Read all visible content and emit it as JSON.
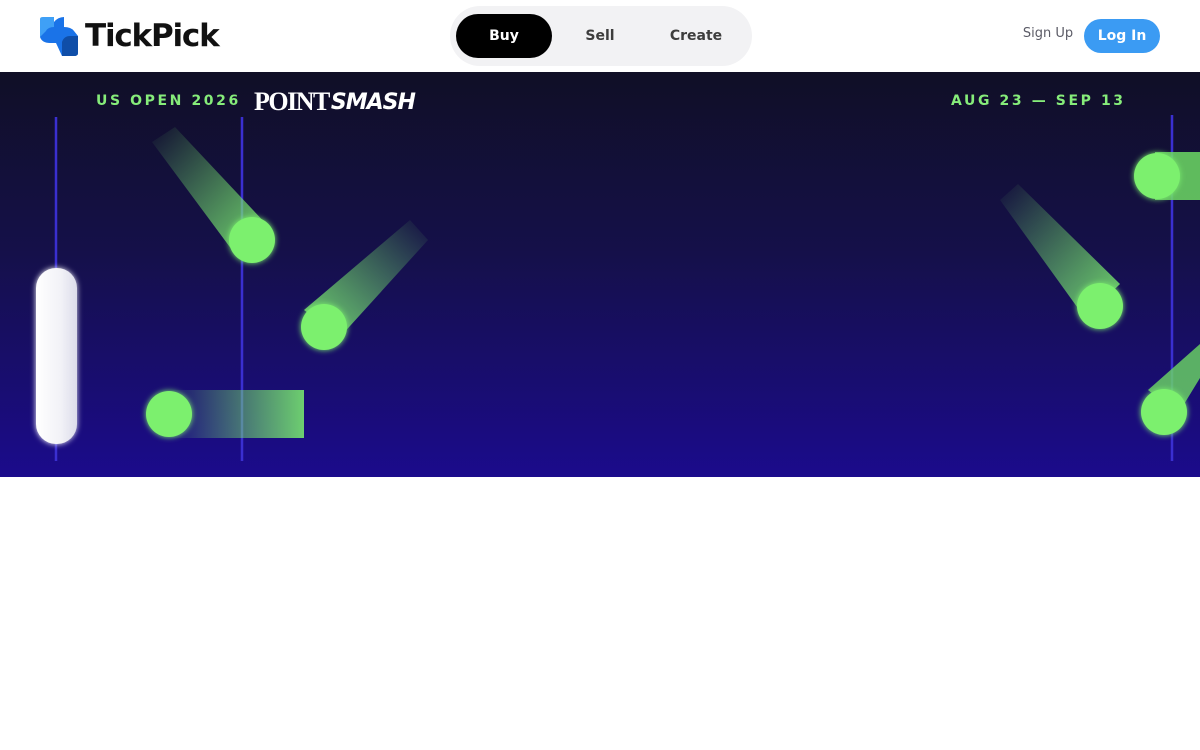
{
  "header": {
    "logo_text": "TickPick",
    "logo_icon": "tickpick-logo-icon",
    "nav": {
      "buy_label": "Buy",
      "sell_label": "Sell",
      "create_label": "Create",
      "active": "Buy"
    },
    "sign_up_label": "Sign Up",
    "log_in_label": "Log In"
  },
  "hero": {
    "event_name": "US OPEN 2026",
    "brand_part1": "POINT",
    "brand_part2": "SMASH",
    "dates": "AUG 23 — SEP 13"
  },
  "colors": {
    "accent_blue": "#3b9bf3",
    "ball_green": "#7cf06e",
    "event_text_green": "#86ec7a",
    "court_line": "#3a2fd0",
    "hero_top": "#100f26",
    "hero_bottom": "#1b0b8c"
  }
}
